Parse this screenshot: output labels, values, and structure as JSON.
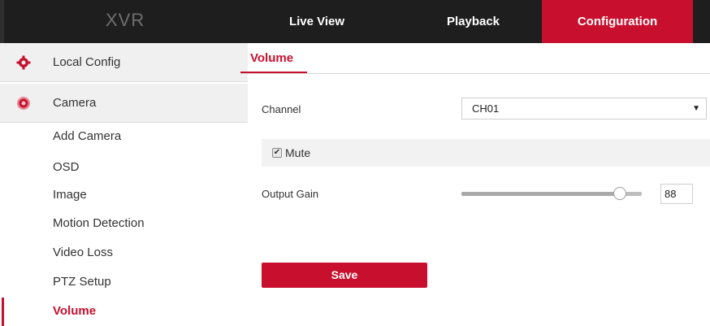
{
  "header": {
    "logo": "XVR",
    "tabs": [
      {
        "label": "Live View"
      },
      {
        "label": "Playback"
      },
      {
        "label": "Configuration",
        "active": true
      }
    ]
  },
  "sidebar": {
    "sections": [
      {
        "label": "Local Config",
        "icon": "gear-icon"
      },
      {
        "label": "Camera",
        "icon": "camera-icon"
      }
    ],
    "items": [
      {
        "label": "Add Camera"
      },
      {
        "label": "OSD"
      },
      {
        "label": "Image"
      },
      {
        "label": "Motion Detection"
      },
      {
        "label": "Video Loss"
      },
      {
        "label": "PTZ Setup"
      },
      {
        "label": "Volume",
        "active": true
      }
    ]
  },
  "main": {
    "tab_label": "Volume",
    "channel": {
      "label": "Channel",
      "value": "CH01"
    },
    "mute": {
      "label": "Mute",
      "checked": true
    },
    "output_gain": {
      "label": "Output Gain",
      "value": "88",
      "level_percent": 88
    },
    "save_label": "Save"
  },
  "colors": {
    "accent": "#c8102e",
    "topbar": "#1e1e1e",
    "sidebar_section_bg": "#f0f0f0"
  }
}
